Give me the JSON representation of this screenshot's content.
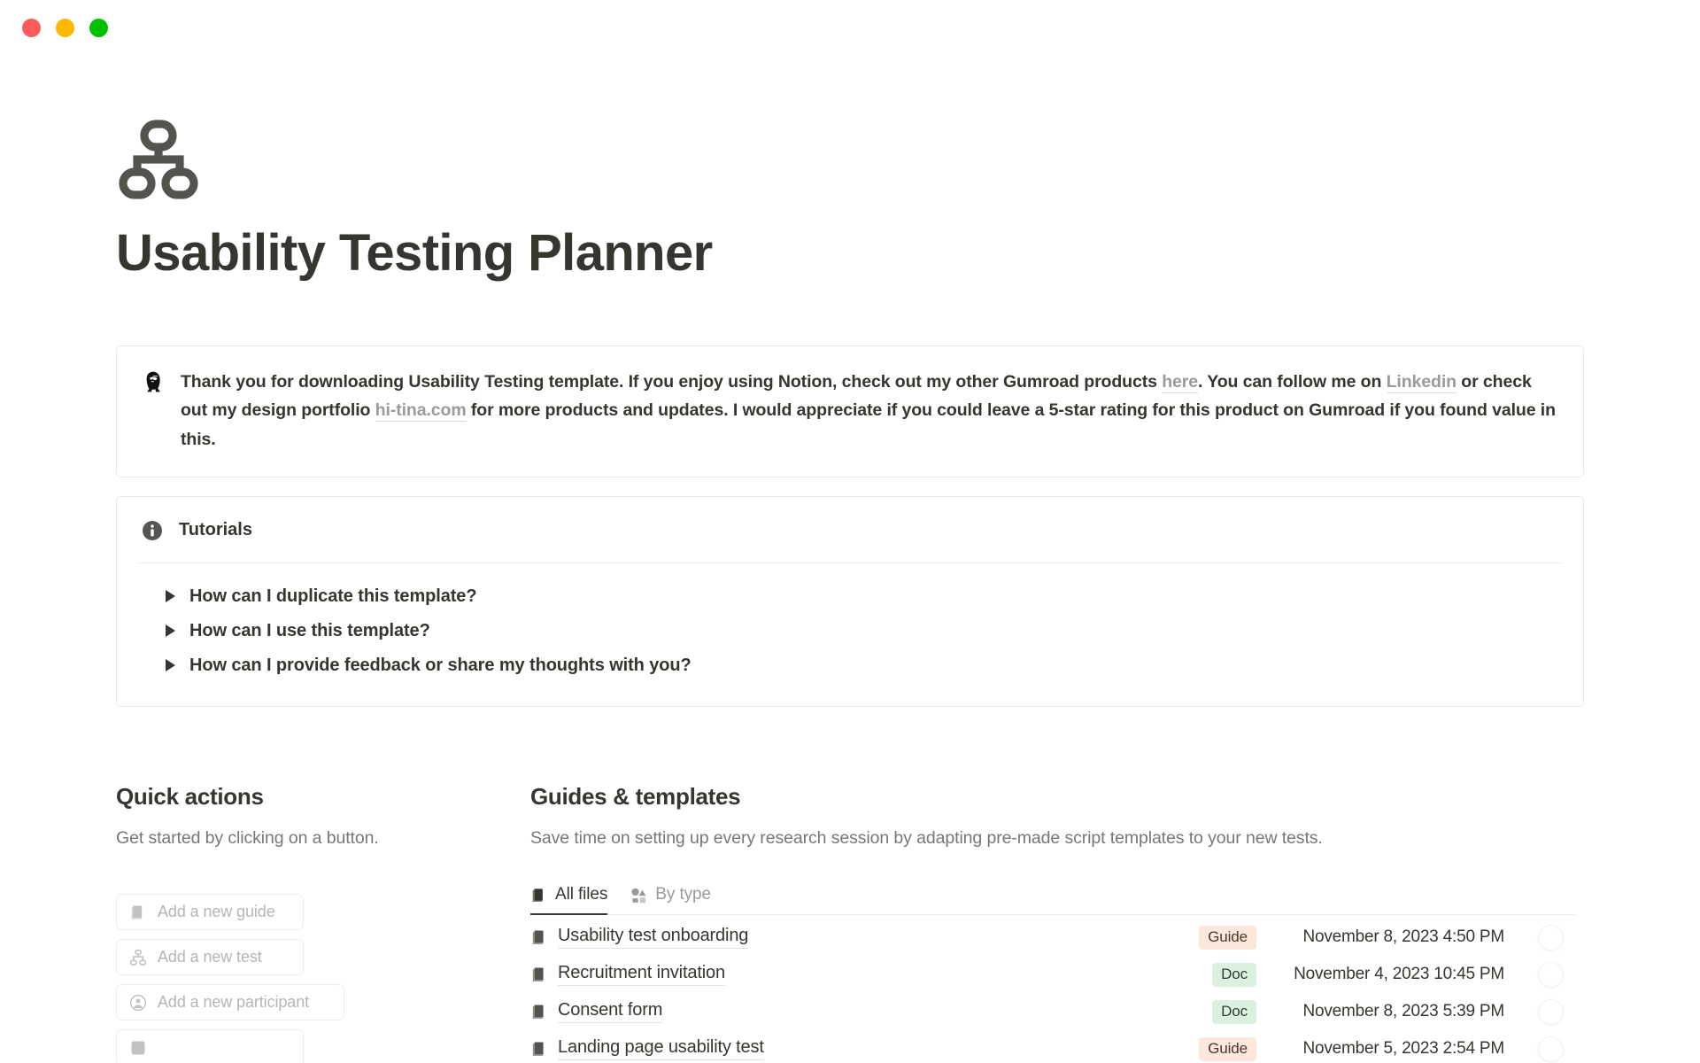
{
  "window": {
    "traffic_lights": [
      {
        "name": "close",
        "color": "#ff5a5a"
      },
      {
        "name": "minimize",
        "color": "#ffb800"
      },
      {
        "name": "maximize",
        "color": "#00c000"
      }
    ]
  },
  "page": {
    "icon": "hierarchy-icon",
    "title": "Usability Testing Planner"
  },
  "thanks_callout": {
    "icon": "woman-with-sunglasses-emoji",
    "segments": [
      {
        "type": "text",
        "value": "Thank you for downloading Usability Testing template. If you enjoy using Notion, check out my other Gumroad products "
      },
      {
        "type": "link",
        "value": "here"
      },
      {
        "type": "text",
        "value": ". You can follow me on "
      },
      {
        "type": "link",
        "value": "Linkedin"
      },
      {
        "type": "text",
        "value": " or check out my design portfolio "
      },
      {
        "type": "link",
        "value": "hi-tina.com"
      },
      {
        "type": "text",
        "value": " for more products and updates. I would appreciate if you could leave a 5-star rating for this product on Gumroad if you found value in this."
      }
    ],
    "link_color": "#9b9a97"
  },
  "tutorials": {
    "icon": "info-icon",
    "title": "Tutorials",
    "toggles": [
      {
        "label": "How can I duplicate this template?"
      },
      {
        "label": "How can I use this template?"
      },
      {
        "label": "How can I provide feedback or share my thoughts with you?"
      }
    ]
  },
  "quick_actions": {
    "title": "Quick actions",
    "subtitle": "Get started by clicking on a button.",
    "buttons": [
      {
        "label": "Add a new guide",
        "icon": "book-icon"
      },
      {
        "label": "Add a new test",
        "icon": "hierarchy-icon"
      },
      {
        "label": "Add a new participant",
        "icon": "person-circle-icon"
      },
      {
        "label": "",
        "icon": "partial-icon"
      }
    ]
  },
  "guides": {
    "title": "Guides & templates",
    "subtitle": "Save time on setting up every research session by adapting pre-made script templates to your new tests.",
    "tabs": [
      {
        "label": "All files",
        "icon": "book-icon",
        "active": true
      },
      {
        "label": "By type",
        "icon": "group-shapes-icon",
        "active": false
      }
    ],
    "rows": [
      {
        "name": "Usability test onboarding",
        "icon": "book-icon",
        "tag": "Guide",
        "tag_type": "guide",
        "date": "November 8, 2023 4:50 PM",
        "avatar": ""
      },
      {
        "name": "Recruitment invitation",
        "icon": "book-icon",
        "tag": "Doc",
        "tag_type": "doc",
        "date": "November 4, 2023 10:45 PM",
        "avatar": ""
      },
      {
        "name": "Consent form",
        "icon": "book-icon",
        "tag": "Doc",
        "tag_type": "doc",
        "date": "November 8, 2023 5:39 PM",
        "avatar": ""
      },
      {
        "name": "Landing page usability test",
        "icon": "book-icon",
        "tag": "Guide",
        "tag_type": "guide",
        "date": "November 5, 2023 2:54 PM",
        "avatar": ""
      }
    ],
    "tag_colors": {
      "guide_bg": "#fbe7dc",
      "doc_bg": "#dcf0df"
    }
  }
}
